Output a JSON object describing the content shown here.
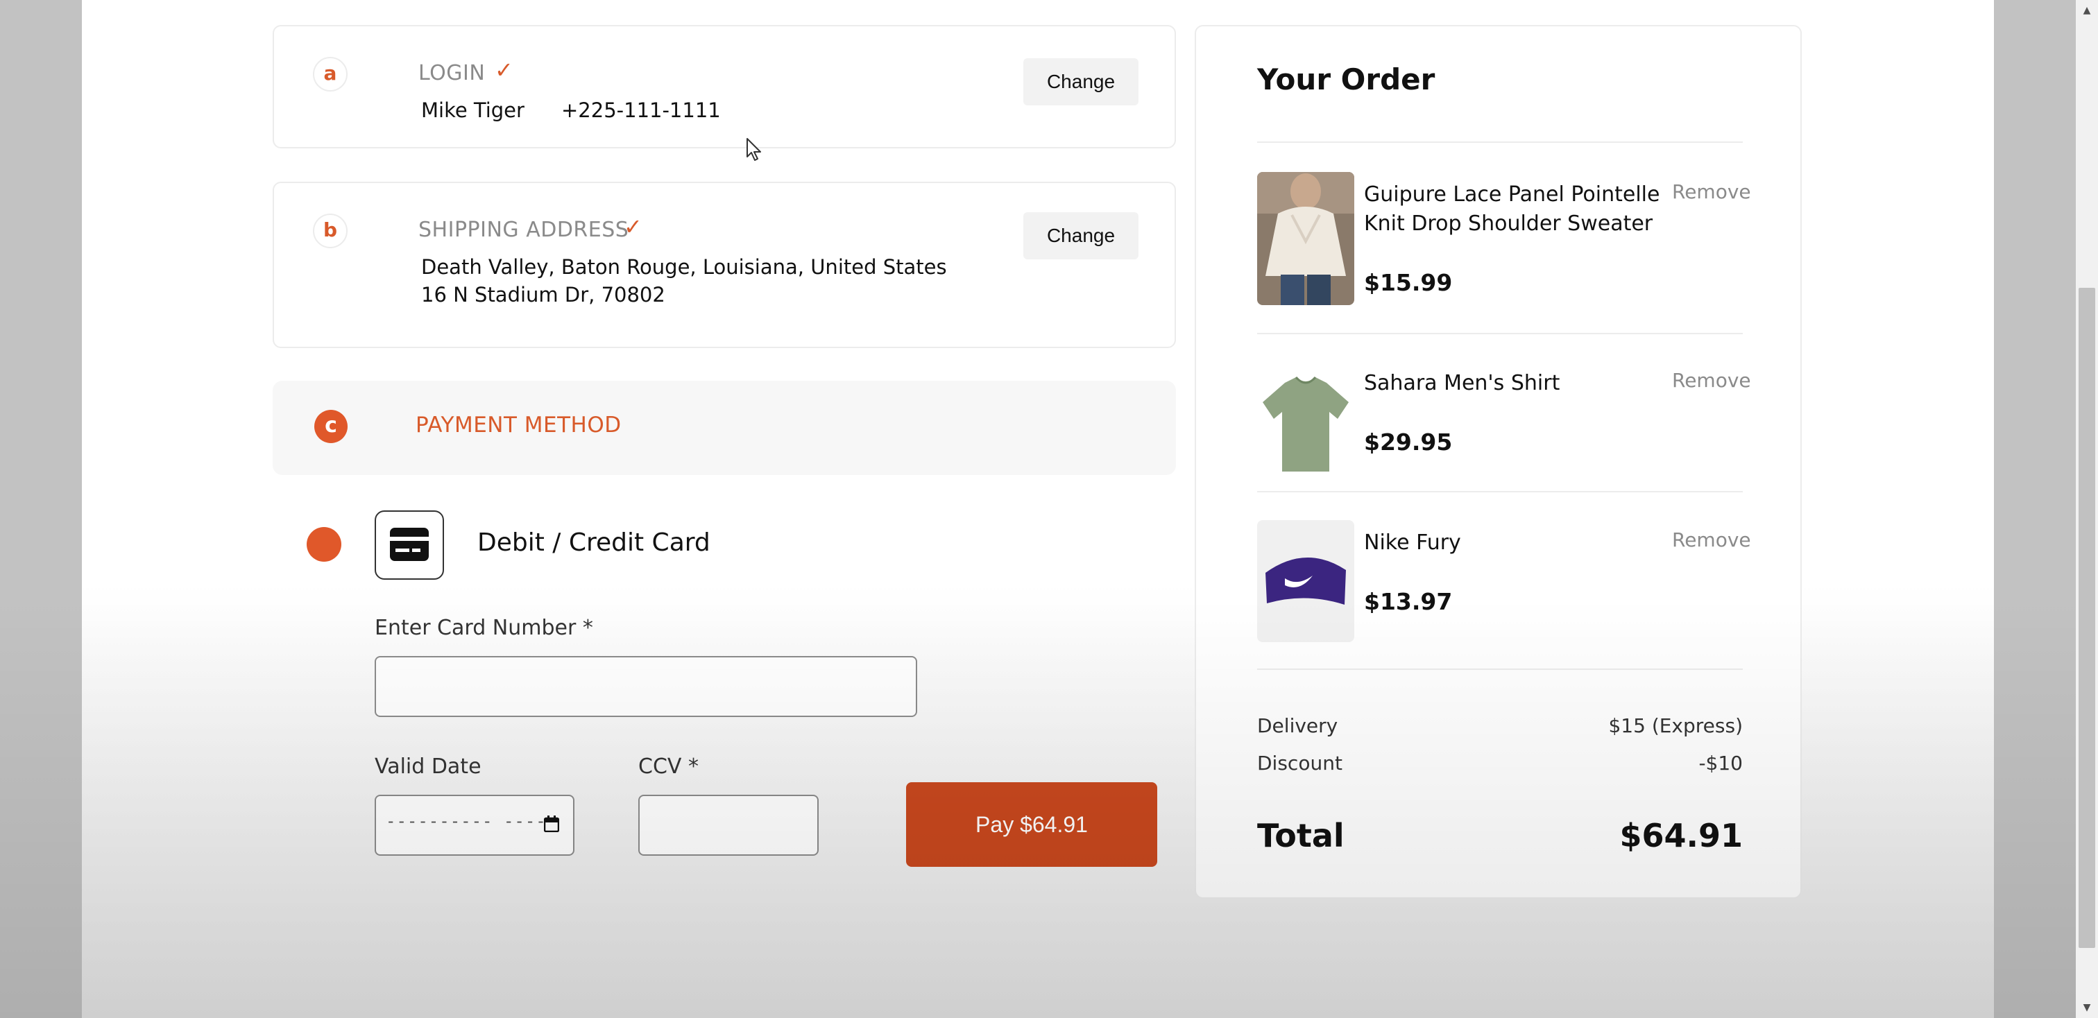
{
  "steps": {
    "login": {
      "badge": "a",
      "title": "LOGIN",
      "name": "Mike Tiger",
      "phone": "+225-111-1111",
      "change_label": "Change"
    },
    "shipping": {
      "badge": "b",
      "title": "SHIPPING ADDRESS",
      "line1": "Death Valley, Baton Rouge, Louisiana, United States",
      "line2": "16 N Stadium Dr, 70802",
      "change_label": "Change"
    },
    "payment": {
      "badge": "c",
      "title": "PAYMENT METHOD"
    }
  },
  "payment_form": {
    "method_label": "Debit / Credit Card",
    "card_number_label": "Enter Card Number *",
    "card_number_value": "",
    "valid_date_label": "Valid Date",
    "valid_date_placeholder": "----------  ----",
    "ccv_label": "CCV *",
    "ccv_value": "",
    "pay_label": "Pay $64.91"
  },
  "order": {
    "title": "Your Order",
    "items": [
      {
        "name": "Guipure Lace Panel Pointelle Knit Drop Shoulder Sweater",
        "price": "$15.99",
        "remove_label": "Remove",
        "thumb_icon": "sweater-photo"
      },
      {
        "name": "Sahara Men's Shirt",
        "price": "$29.95",
        "remove_label": "Remove",
        "thumb_icon": "tshirt-photo"
      },
      {
        "name": "Nike Fury",
        "price": "$13.97",
        "remove_label": "Remove",
        "thumb_icon": "headband-photo"
      }
    ],
    "delivery_label": "Delivery",
    "delivery_value": "$15 (Express)",
    "discount_label": "Discount",
    "discount_value": "-$10",
    "total_label": "Total",
    "total_value": "$64.91"
  },
  "colors": {
    "accent": "#e0582a",
    "pay_button": "#c9481e",
    "muted_text": "#8a8a8a"
  }
}
